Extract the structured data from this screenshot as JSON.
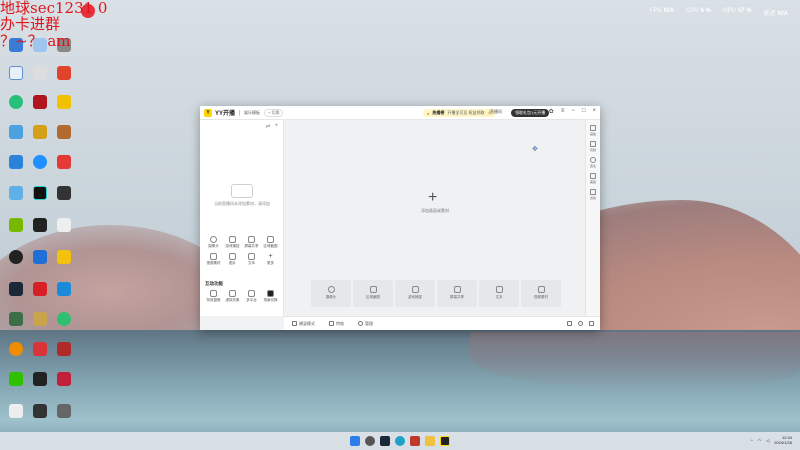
{
  "overlay": {
    "line1": "地球sec1231 0",
    "line2": "办卡进群",
    "line3": "？~？ am"
  },
  "stats": {
    "fps_label": "FPS",
    "fps": "N/A",
    "cpu_label": "CPU",
    "cpu": "6 %",
    "gpu_label": "GPU",
    "gpu": "57 %",
    "latency_label": "延迟",
    "latency": "N/A"
  },
  "app": {
    "name": "YY开播",
    "mode": "娱乐模板",
    "pill": "+ 切换",
    "promo_title": "热播榜",
    "promo_text": "开播全可见 权益领取",
    "promo_badge": "天",
    "promo2": "直播间",
    "dark_pill": "领取礼包1元开播",
    "tooltip": "新人开播指南，开播开播体验",
    "left_empty": "当前直播间未添加素材，请添加",
    "tools": [
      "摄像头",
      "游戏捕捉",
      "屏幕共享",
      "区域截图",
      "视频素材",
      "图片",
      "文本",
      "更多"
    ],
    "section_title": "互动功能",
    "tools2": [
      "特效摄像",
      "虚拟形象",
      "多平台",
      "场景切换"
    ],
    "canvas_hint": "添加画面或素材",
    "tiles": [
      "摄像头",
      "区域截图",
      "游戏捕捉",
      "屏幕共享",
      "文本",
      "视频素材"
    ],
    "right_items": [
      "画板",
      "音频",
      "连麦",
      "美颜",
      "滤镜"
    ],
    "status_items": [
      "横竖模式",
      "特效",
      "管理"
    ]
  },
  "taskbar": {
    "time": "12:34",
    "date": "2024/1/26"
  }
}
